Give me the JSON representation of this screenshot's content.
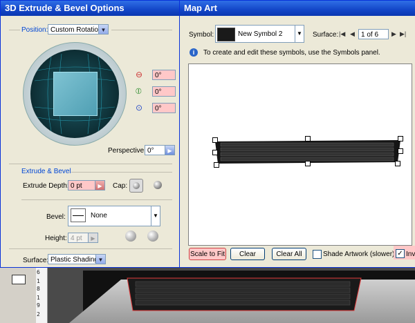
{
  "extrude_dialog": {
    "title": "3D Extrude & Bevel Options",
    "position_label": "Position:",
    "position_value": "Custom Rotation",
    "rot_x": "0°",
    "rot_y": "0°",
    "rot_z": "0°",
    "perspective_label": "Perspective:",
    "perspective_value": "0°",
    "extrude_section": "Extrude & Bevel",
    "extrude_depth_label": "Extrude Depth:",
    "extrude_depth_value": "0 pt",
    "cap_label": "Cap:",
    "bevel_label": "Bevel:",
    "bevel_value": "None",
    "height_label": "Height:",
    "height_value": "4 pt",
    "surface_label": "Surface:",
    "surface_value": "Plastic Shading"
  },
  "map_art_dialog": {
    "title": "Map Art",
    "symbol_label": "Symbol:",
    "symbol_value": "New Symbol 2",
    "surface_label": "Surface:",
    "surface_value": "1 of 6",
    "info_text": "To create and edit these symbols, use the Symbols panel.",
    "buttons": {
      "scale_to_fit": "Scale to Fit",
      "clear": "Clear",
      "clear_all": "Clear All"
    },
    "shade_artwork_label": "Shade Artwork (slower)",
    "invisible_label": "Inv"
  },
  "ruler": {
    "numbers": [
      "6",
      "1",
      "8",
      "1",
      "9",
      "2"
    ]
  },
  "colors": {
    "titlebar": "#1346c8",
    "dialog_bg": "#ece9d8",
    "pink_field": "#ffc8c8",
    "group_label": "#0046d5"
  }
}
